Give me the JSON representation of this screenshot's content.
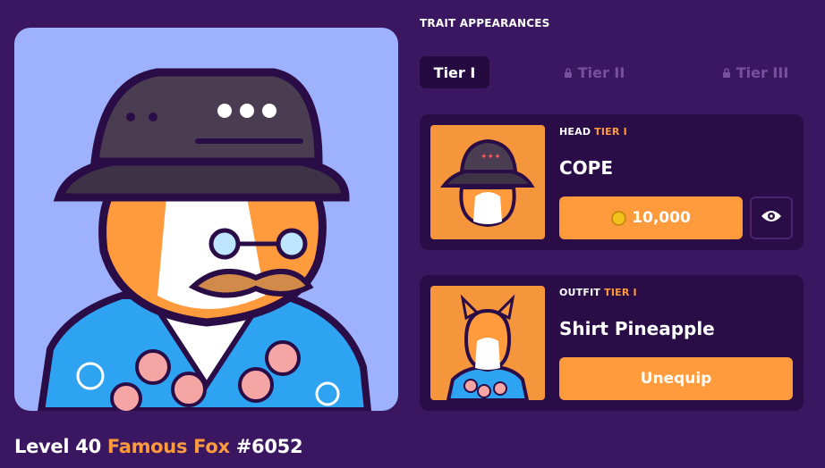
{
  "header": {
    "section_title": "TRAIT APPEARANCES"
  },
  "tabs": [
    {
      "label": "Tier I",
      "active": true,
      "locked": false
    },
    {
      "label": "Tier II",
      "active": false,
      "locked": true
    },
    {
      "label": "Tier III",
      "active": false,
      "locked": true
    }
  ],
  "traits": [
    {
      "type": "HEAD",
      "tier": "TIER I",
      "name": "COPE",
      "price": "10,000",
      "price_icon": "coin-icon",
      "secondary_icon": "eye-icon"
    },
    {
      "type": "OUTFIT",
      "tier": "TIER I",
      "name": "Shirt Pineapple",
      "action": "Unequip"
    }
  ],
  "footer": {
    "level_prefix": "Level 40",
    "collection": "Famous Fox",
    "token_id": "#6052"
  },
  "colors": {
    "background": "#3a1760",
    "card": "#2a0c46",
    "accent": "#ff9b3d",
    "image_bg": "#9db1fc",
    "thumb_bg": "#f6963c"
  }
}
